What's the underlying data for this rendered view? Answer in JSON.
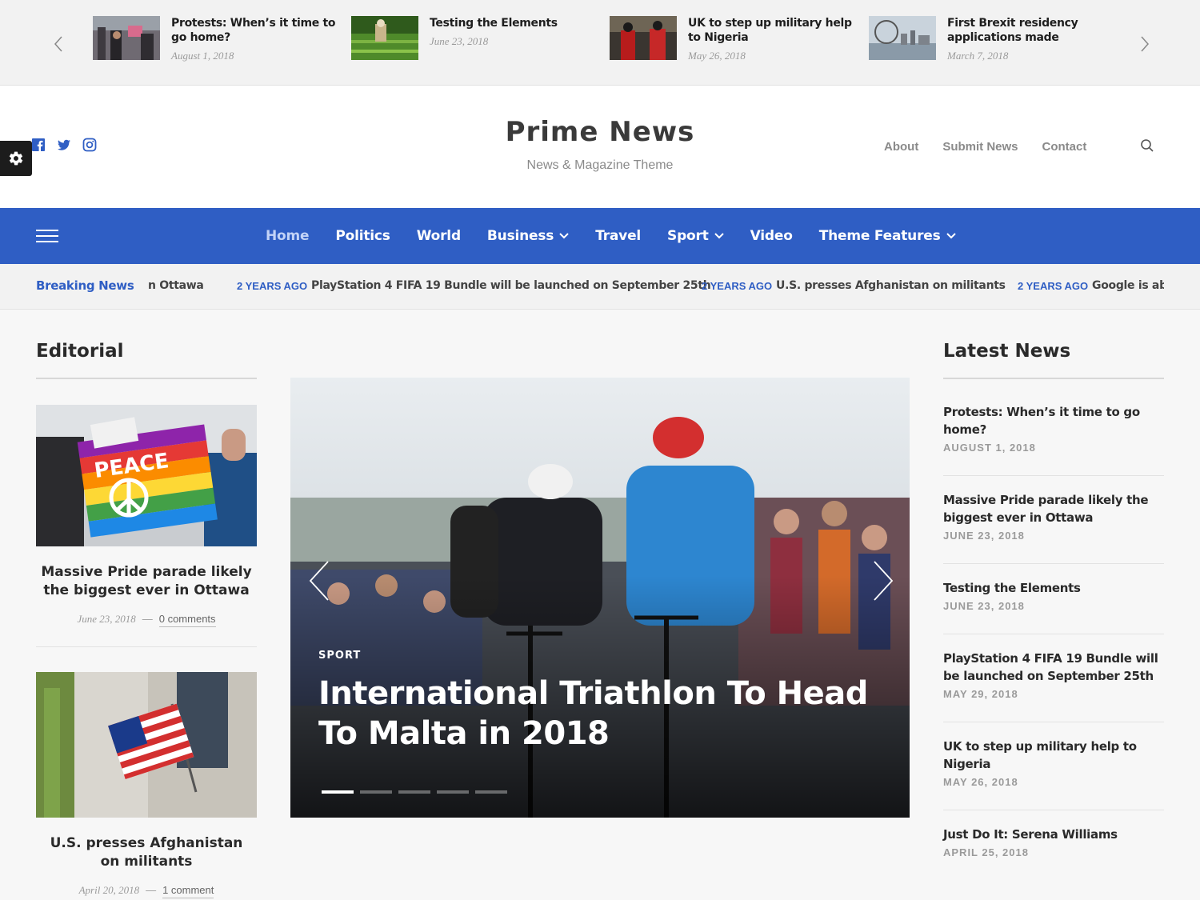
{
  "top_carousel": {
    "items": [
      {
        "title": "Protests: When’s it time to go home?",
        "date": "August 1, 2018"
      },
      {
        "title": "Testing the Elements",
        "date": "June 23, 2018"
      },
      {
        "title": "UK to step up military help to Nigeria",
        "date": "May 26, 2018"
      },
      {
        "title": "First Brexit residency applications made",
        "date": "March 7, 2018"
      }
    ]
  },
  "header": {
    "site_title": "Prime News",
    "tagline": "News & Magazine Theme",
    "top_nav": [
      "About",
      "Submit News",
      "Contact"
    ],
    "socials": [
      "facebook-icon",
      "twitter-icon",
      "instagram-icon"
    ]
  },
  "main_nav": {
    "items": [
      {
        "label": "Home",
        "active": true,
        "dropdown": false
      },
      {
        "label": "Politics",
        "dropdown": false
      },
      {
        "label": "World",
        "dropdown": false
      },
      {
        "label": "Business",
        "dropdown": true
      },
      {
        "label": "Travel",
        "dropdown": false
      },
      {
        "label": "Sport",
        "dropdown": true
      },
      {
        "label": "Video",
        "dropdown": false
      },
      {
        "label": "Theme Features",
        "dropdown": true
      }
    ]
  },
  "breaking": {
    "label": "Breaking News",
    "lead_fragment": "n Ottawa",
    "items": [
      {
        "ago": "2 YEARS AGO",
        "text": "PlayStation 4 FIFA 19 Bundle will be launched on September 25th"
      },
      {
        "ago": "2 YEARS AGO",
        "text": "U.S. presses Afghanistan on militants"
      },
      {
        "ago": "2 YEARS AGO",
        "text": "Google is abou"
      }
    ]
  },
  "editorial": {
    "heading": "Editorial",
    "cards": [
      {
        "title": "Massive Pride parade likely the biggest ever in Ottawa",
        "date": "June 23, 2018",
        "sep": "—",
        "comments": "0 comments"
      },
      {
        "title": "U.S. presses Afghanistan on militants",
        "date": "April 20, 2018",
        "sep": "—",
        "comments": "1 comment"
      }
    ]
  },
  "slider": {
    "category": "SPORT",
    "title": "International Triathlon To Head To Malta in 2018",
    "slide_count": 5,
    "active_slide": 1
  },
  "latest": {
    "heading": "Latest News",
    "items": [
      {
        "title": "Protests: When’s it time to go home?",
        "date": "August 1, 2018"
      },
      {
        "title": "Massive Pride parade likely the biggest ever in Ottawa",
        "date": "June 23, 2018"
      },
      {
        "title": "Testing the Elements",
        "date": "June 23, 2018"
      },
      {
        "title": "PlayStation 4 FIFA 19 Bundle will be launched on September 25th",
        "date": "May 29, 2018"
      },
      {
        "title": "UK to step up military help to Nigeria",
        "date": "May 26, 2018"
      },
      {
        "title": "Just Do It: Serena Williams",
        "date": "April 25, 2018"
      }
    ]
  },
  "colors": {
    "accent": "#2f5ec4",
    "text": "#2a2a2a",
    "muted": "#9a9a9a"
  }
}
